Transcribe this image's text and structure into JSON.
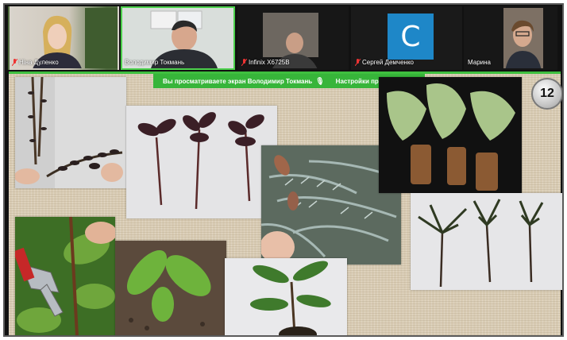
{
  "participants": [
    {
      "name": "Ніна Дуленко",
      "muted": true
    },
    {
      "name": "Володимир Токмань",
      "muted": false,
      "active": true
    },
    {
      "name": "Infinix X6725B",
      "muted": true
    },
    {
      "name": "Сергей Демченко",
      "muted": true,
      "avatar_letter": "C"
    },
    {
      "name": "Марина",
      "muted": false
    }
  ],
  "share_banner": {
    "text": "Вы просматриваете экран  Володимир Токмань",
    "view_options": "Настройки просмотра"
  },
  "slide": {
    "number_badge": "12"
  },
  "colors": {
    "active_border": "#4cd04c",
    "banner_bg": "#37b53a",
    "avatar_bg": "#1e87c8"
  }
}
